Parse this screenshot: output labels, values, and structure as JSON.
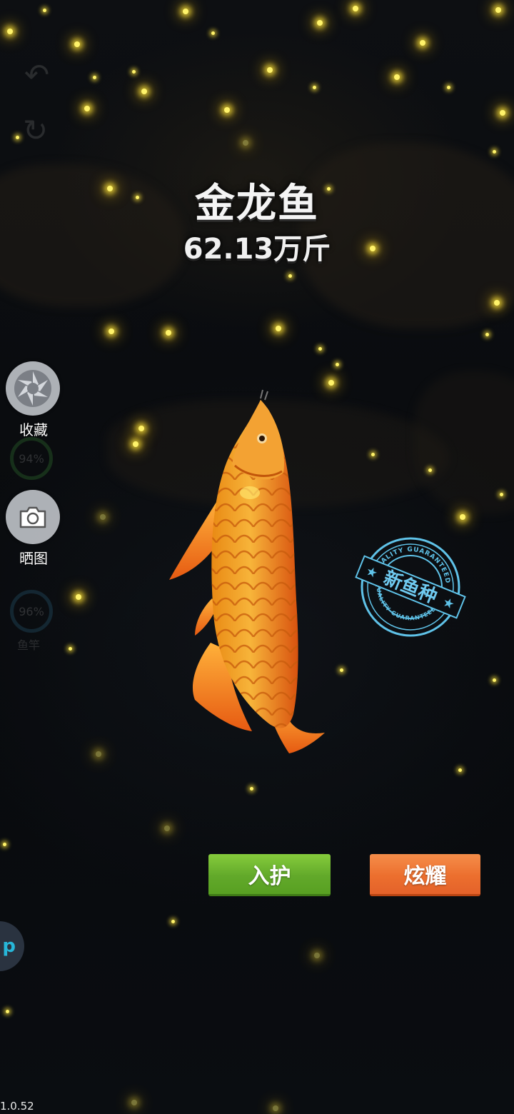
{
  "fish": {
    "name": "金龙鱼",
    "weight": "62.13万斤",
    "stamp_text": "新鱼种",
    "stamp_ring_text": "QUALITY GUARANTEED"
  },
  "side_buttons": [
    {
      "label": "收藏",
      "icon": "aperture-icon"
    },
    {
      "label": "晒图",
      "icon": "camera-icon"
    }
  ],
  "background_hud": {
    "gauge_1": "94%",
    "gauge_2": "96%",
    "gauge_2_label": "鱼竿"
  },
  "actions": {
    "release_label": "入护",
    "show_off_label": "炫耀"
  },
  "app_badge": "p",
  "version": "1.0.52",
  "colors": {
    "green_button": "#6bb42e",
    "orange_button": "#ec6f2e",
    "stamp_blue": "#5fc2e8",
    "firefly": "#fff36a"
  }
}
